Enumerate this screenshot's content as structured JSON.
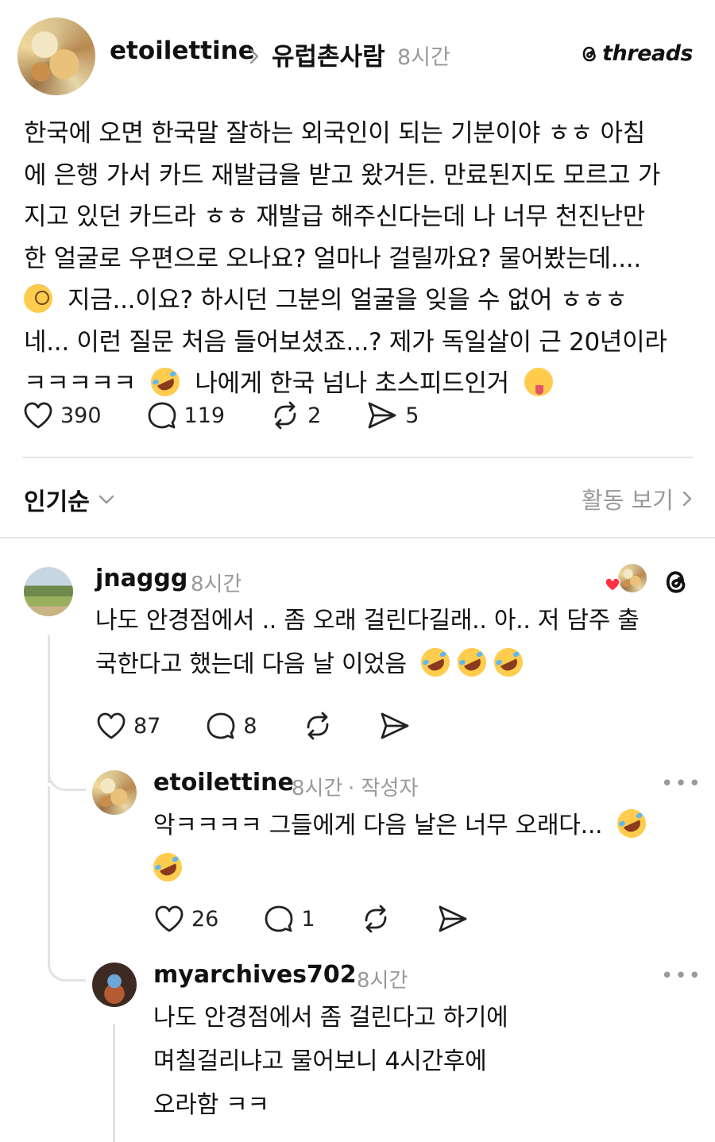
{
  "post": {
    "author": "etoilettine",
    "reply_to": "유럽촌사람",
    "time": "8시간",
    "brand": "threads",
    "lines": [
      "한국에 오면 한국말 잘하는 외국인이 되는 기분이야 ㅎㅎ 아침",
      "에 은행 가서 카드 재발급을 받고 왔거든. 만료된지도 모르고 가",
      "지고 있던 카드라 ㅎㅎ 재발급 해주신다는데 나 너무 천진난만",
      "한 얼굴로 우편으로 오나요? 얼마나 걸릴까요? 물어봤는데....",
      "지금...이요? 하시던 그분의 얼굴을 잊을 수 없어 ㅎㅎㅎ",
      "네... 이런 질문 처음 들어보셨죠...? 제가 독일살이 근 20년이라",
      "ㅋㅋㅋㅋㅋ",
      "나에게 한국 넘나 초스피드인거"
    ],
    "likes": "390",
    "comments": "119",
    "reposts": "2",
    "shares": "5"
  },
  "sort": {
    "label": "인기순",
    "activity": "활동 보기"
  },
  "comments": [
    {
      "author": "jnaggg",
      "time": "8시간",
      "lines": [
        "나도 안경점에서 .. 좀 오래 걸린다길래.. 아.. 저 담주 출",
        "국한다고 했는데 다음 날 이었음"
      ],
      "likes": "87",
      "comments": "8"
    },
    {
      "author": "etoilettine",
      "time": "8시간",
      "author_tag": "· 작성자",
      "lines": [
        "악ㅋㅋㅋㅋ 그들에게 다음 날은 너무 오래다..."
      ],
      "likes": "26",
      "comments": "1"
    },
    {
      "author": "myarchives702",
      "time": "8시간",
      "lines": [
        "나도 안경점에서 좀 걸린다고 하기에",
        "며칠걸리냐고 물어보니 4시간후에",
        "오라함 ㅋㅋ"
      ]
    }
  ]
}
